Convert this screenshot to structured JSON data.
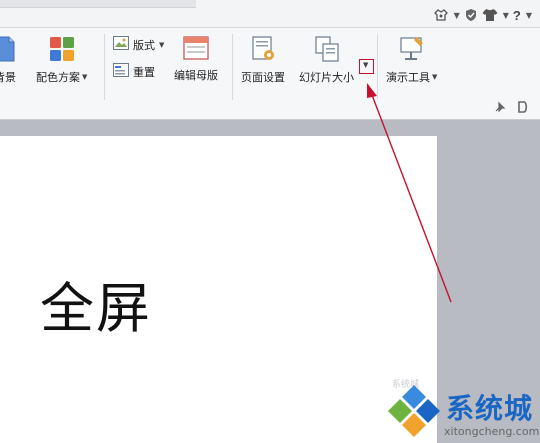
{
  "topbar": {
    "icons": [
      "skin-icon",
      "shield-icon",
      "shirt-icon",
      "help-icon"
    ],
    "help_label": "?"
  },
  "ribbon": {
    "groups": [
      {
        "label": "背景",
        "icon": "background-icon"
      },
      {
        "label": "配色方案",
        "icon": "color-scheme-icon",
        "has_dropdown": true
      },
      {
        "layout_label": "版式",
        "reset_label": "重置"
      },
      {
        "label": "编辑母版",
        "icon": "edit-master-icon"
      },
      {
        "label": "页面设置",
        "icon": "page-setup-icon"
      },
      {
        "label": "幻灯片大小",
        "icon": "slide-size-icon",
        "has_dropdown": true
      },
      {
        "label": "演示工具",
        "icon": "presentation-tools-icon",
        "has_dropdown": true
      }
    ]
  },
  "slide": {
    "title": "全屏"
  },
  "watermark": {
    "brand": "系统城",
    "url": "xitongcheng.com",
    "faint": "系统城"
  },
  "colors": {
    "annotation_red": "#c8102e",
    "brand_blue": "#1a66c4"
  }
}
